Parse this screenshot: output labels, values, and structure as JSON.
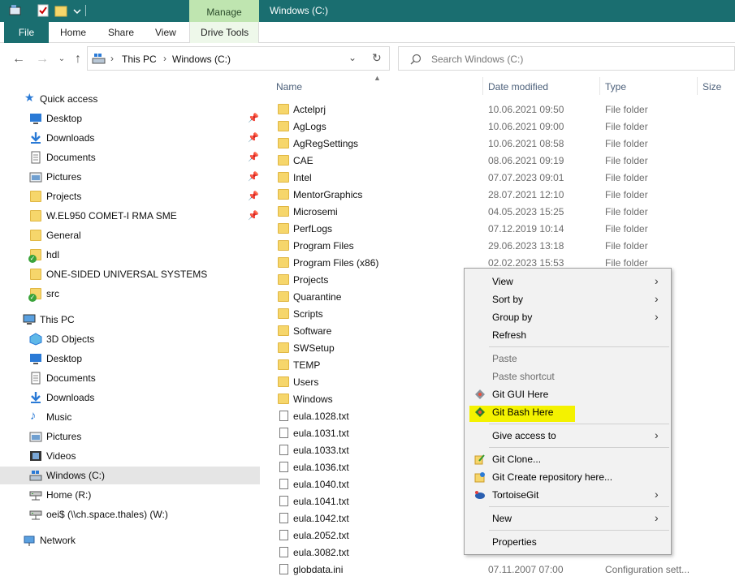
{
  "title_bar": {
    "contextual_tab": "Manage",
    "window_title": "Windows (C:)"
  },
  "ribbon": {
    "file": "File",
    "tabs": [
      "Home",
      "Share",
      "View",
      "Drive Tools"
    ]
  },
  "address": {
    "crumbs": [
      "This PC",
      "Windows (C:)"
    ],
    "search_placeholder": "Search Windows (C:)"
  },
  "nav_pane": {
    "quick_access": "Quick access",
    "quick_items": [
      {
        "label": "Desktop",
        "pinned": true
      },
      {
        "label": "Downloads",
        "pinned": true
      },
      {
        "label": "Documents",
        "pinned": true
      },
      {
        "label": "Pictures",
        "pinned": true
      },
      {
        "label": "Projects",
        "pinned": true
      },
      {
        "label": "W.EL950 COMET-I RMA SME",
        "pinned": true
      },
      {
        "label": "General",
        "pinned": false
      },
      {
        "label": "hdl",
        "pinned": false
      },
      {
        "label": "ONE-SIDED UNIVERSAL SYSTEMS",
        "pinned": false
      },
      {
        "label": "src",
        "pinned": false
      }
    ],
    "this_pc": "This PC",
    "pc_items": [
      "3D Objects",
      "Desktop",
      "Documents",
      "Downloads",
      "Music",
      "Pictures",
      "Videos",
      "Windows (C:)",
      "Home (R:)",
      "oei$ (\\\\ch.space.thales) (W:)"
    ],
    "network": "Network"
  },
  "columns": {
    "name": "Name",
    "date": "Date modified",
    "type": "Type",
    "size": "Size"
  },
  "files": [
    {
      "name": "Actelprj",
      "date": "10.06.2021 09:50",
      "type": "File folder",
      "kind": "folder"
    },
    {
      "name": "AgLogs",
      "date": "10.06.2021 09:00",
      "type": "File folder",
      "kind": "folder"
    },
    {
      "name": "AgRegSettings",
      "date": "10.06.2021 08:58",
      "type": "File folder",
      "kind": "folder"
    },
    {
      "name": "CAE",
      "date": "08.06.2021 09:19",
      "type": "File folder",
      "kind": "folder"
    },
    {
      "name": "Intel",
      "date": "07.07.2023 09:01",
      "type": "File folder",
      "kind": "folder"
    },
    {
      "name": "MentorGraphics",
      "date": "28.07.2021 12:10",
      "type": "File folder",
      "kind": "folder"
    },
    {
      "name": "Microsemi",
      "date": "04.05.2023 15:25",
      "type": "File folder",
      "kind": "folder"
    },
    {
      "name": "PerfLogs",
      "date": "07.12.2019 10:14",
      "type": "File folder",
      "kind": "folder"
    },
    {
      "name": "Program Files",
      "date": "29.06.2023 13:18",
      "type": "File folder",
      "kind": "folder"
    },
    {
      "name": "Program Files (x86)",
      "date": "02.02.2023 15:53",
      "type": "File folder",
      "kind": "folder"
    },
    {
      "name": "Projects",
      "date": "",
      "type": "",
      "kind": "folder"
    },
    {
      "name": "Quarantine",
      "date": "",
      "type": "",
      "kind": "folder"
    },
    {
      "name": "Scripts",
      "date": "",
      "type": "",
      "kind": "folder"
    },
    {
      "name": "Software",
      "date": "",
      "type": "",
      "kind": "folder"
    },
    {
      "name": "SWSetup",
      "date": "",
      "type": "",
      "kind": "folder"
    },
    {
      "name": "TEMP",
      "date": "",
      "type": "",
      "kind": "folder"
    },
    {
      "name": "Users",
      "date": "",
      "type": "",
      "kind": "folder"
    },
    {
      "name": "Windows",
      "date": "",
      "type": "",
      "kind": "folder"
    },
    {
      "name": "eula.1028.txt",
      "date": "",
      "type": "",
      "kind": "txt"
    },
    {
      "name": "eula.1031.txt",
      "date": "",
      "type": "",
      "kind": "txt"
    },
    {
      "name": "eula.1033.txt",
      "date": "",
      "type": "",
      "kind": "txt"
    },
    {
      "name": "eula.1036.txt",
      "date": "",
      "type": "",
      "kind": "txt"
    },
    {
      "name": "eula.1040.txt",
      "date": "",
      "type": "",
      "kind": "txt"
    },
    {
      "name": "eula.1041.txt",
      "date": "",
      "type": "",
      "kind": "txt"
    },
    {
      "name": "eula.1042.txt",
      "date": "",
      "type": "",
      "kind": "txt"
    },
    {
      "name": "eula.2052.txt",
      "date": "",
      "type": "",
      "kind": "txt"
    },
    {
      "name": "eula.3082.txt",
      "date": "",
      "type": "",
      "kind": "txt"
    },
    {
      "name": "globdata.ini",
      "date": "07.11.2007 07:00",
      "type": "Configuration sett...",
      "kind": "ini"
    }
  ],
  "context_menu": {
    "view": "View",
    "sort_by": "Sort by",
    "group_by": "Group by",
    "refresh": "Refresh",
    "paste": "Paste",
    "paste_shortcut": "Paste shortcut",
    "git_gui": "Git GUI Here",
    "git_bash": "Git Bash Here",
    "give_access": "Give access to",
    "git_clone": "Git Clone...",
    "git_create_repo": "Git Create repository here...",
    "tortoisegit": "TortoiseGit",
    "new": "New",
    "properties": "Properties"
  },
  "colors": {
    "title_bar": "#1a6e70",
    "manage_tab": "#bfe5b0",
    "highlight": "#f4f200"
  }
}
